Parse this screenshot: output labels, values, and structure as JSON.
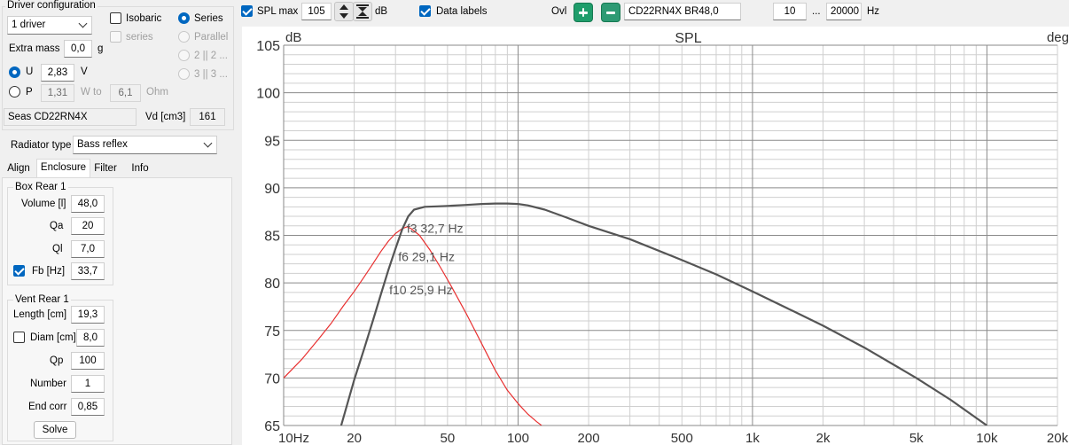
{
  "driver_config": {
    "title": "Driver configuration",
    "driver_count": "1 driver",
    "isobaric_label": "Isobaric",
    "series_cb_label": "series",
    "series_radio_label": "Series",
    "parallel_label": "Parallel",
    "opt_2x2_label": "2 || 2 ...",
    "opt_3x3_label": "3 || 3 ...",
    "extra_mass_label": "Extra mass",
    "extra_mass_value": "0,0",
    "extra_mass_unit": "g",
    "u_label": "U",
    "u_value": "2,83",
    "u_unit": "V",
    "p_label": "P",
    "p_value": "1,31",
    "w_to_label": "W to",
    "ohm_value": "6,1",
    "ohm_unit": "Ohm",
    "driver_name": "Seas CD22RN4X",
    "vd_label": "Vd [cm3]",
    "vd_value": "161"
  },
  "radiator": {
    "label": "Radiator type",
    "value": "Bass reflex"
  },
  "tabs": [
    {
      "label": "Align",
      "active": false
    },
    {
      "label": "Enclosure",
      "active": true
    },
    {
      "label": "Filter",
      "active": false
    },
    {
      "label": "Info",
      "active": false
    }
  ],
  "box": {
    "title": "Box Rear 1",
    "volume_label": "Volume [l]",
    "volume_value": "48,0",
    "qa_label": "Qa",
    "qa_value": "20",
    "ql_label": "Ql",
    "ql_value": "7,0",
    "fb_label": "Fb [Hz]",
    "fb_value": "33,7"
  },
  "vent": {
    "title": "Vent Rear 1",
    "length_label": "Length [cm]",
    "length_value": "19,3",
    "diam_label": "Diam [cm]",
    "diam_value": "8,0",
    "qp_label": "Qp",
    "qp_value": "100",
    "number_label": "Number",
    "number_value": "1",
    "end_corr_label": "End corr",
    "end_corr_value": "0,85",
    "solve_label": "Solve"
  },
  "toolbar": {
    "spl_max_label": "SPL max",
    "spl_max_value": "105",
    "db_label": "dB",
    "data_labels_label": "Data labels",
    "ovl_label": "Ovl",
    "curve_name": "CD22RN4X BR48,0",
    "f_min": "10",
    "dots": "...",
    "f_max": "20000",
    "hz_label": "Hz"
  },
  "colors": {
    "main_curve": "#555555",
    "red_curve": "#e83030",
    "accent": "#0067c0",
    "grid_major": "#8a8a8a",
    "grid_minor": "#cfcfcf"
  },
  "chart_data": {
    "type": "line",
    "title": "SPL",
    "ylabel": "dB",
    "y2label": "deg",
    "xscale": "log",
    "xlim": [
      10,
      20000
    ],
    "ylim": [
      65,
      105
    ],
    "yticks": [
      65,
      70,
      75,
      80,
      85,
      90,
      95,
      100,
      105
    ],
    "xticks": [
      {
        "value": 10,
        "label": "10Hz"
      },
      {
        "value": 20,
        "label": "20"
      },
      {
        "value": 50,
        "label": "50"
      },
      {
        "value": 100,
        "label": "100"
      },
      {
        "value": 200,
        "label": "200"
      },
      {
        "value": 500,
        "label": "500"
      },
      {
        "value": 1000,
        "label": "1k"
      },
      {
        "value": 2000,
        "label": "2k"
      },
      {
        "value": 5000,
        "label": "5k"
      },
      {
        "value": 10000,
        "label": "10k"
      },
      {
        "value": 20000,
        "label": "20k"
      }
    ],
    "grid": true,
    "series": [
      {
        "x": [
          17.6,
          20,
          22,
          24,
          26,
          28,
          30,
          32,
          34,
          36,
          40,
          45,
          50,
          60,
          70,
          80,
          90,
          100,
          110,
          130,
          160,
          200,
          300,
          500,
          700,
          1000,
          1500,
          2000,
          3000,
          5000,
          7000,
          10000
        ],
        "y": [
          65.0,
          69.8,
          73.0,
          76.0,
          78.8,
          81.4,
          83.6,
          85.6,
          87.0,
          87.7,
          88.0,
          88.05,
          88.1,
          88.2,
          88.3,
          88.35,
          88.35,
          88.3,
          88.15,
          87.7,
          86.9,
          86.0,
          84.6,
          82.4,
          80.9,
          79.1,
          77.0,
          75.5,
          73.2,
          70.0,
          67.7,
          65.0
        ]
      },
      {
        "x": [
          10,
          12,
          14,
          16,
          18,
          20,
          22,
          24,
          26,
          28,
          30,
          32,
          33.7,
          35,
          38,
          42,
          47,
          52,
          60,
          70,
          80,
          90,
          100,
          110,
          120,
          126
        ],
        "y": [
          70.0,
          72.0,
          74.0,
          75.8,
          77.6,
          79.1,
          80.6,
          82.0,
          83.3,
          84.4,
          85.2,
          85.7,
          85.9,
          85.7,
          85.0,
          83.5,
          81.5,
          79.6,
          76.8,
          73.6,
          70.8,
          68.7,
          67.3,
          66.2,
          65.4,
          65.0
        ]
      }
    ],
    "annotations": [
      {
        "text": "f3 32,7 Hz",
        "x": 33.5,
        "y": 85.3
      },
      {
        "text": "f6 29,1 Hz",
        "x": 30.8,
        "y": 82.3
      },
      {
        "text": "f10 25,9 Hz",
        "x": 28.2,
        "y": 78.8
      }
    ]
  }
}
